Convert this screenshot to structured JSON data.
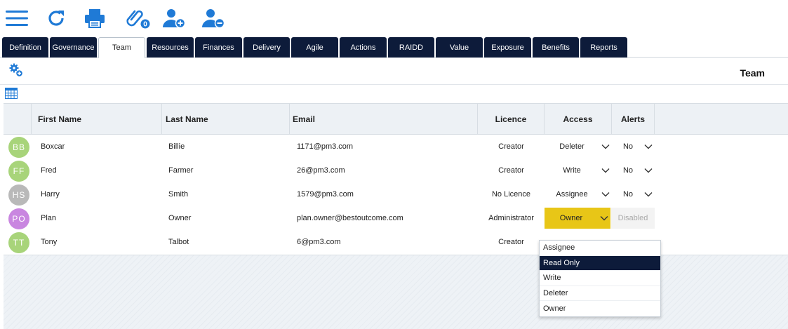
{
  "toolbar": {
    "icons": [
      "menu-icon",
      "refresh-icon",
      "print-icon",
      "paperclip-icon",
      "add-user-icon",
      "remove-user-icon"
    ],
    "attachment_count": "0",
    "accent": "#1f7ad6"
  },
  "tabs": [
    {
      "label": "Definition"
    },
    {
      "label": "Governance"
    },
    {
      "label": "Team",
      "active": true
    },
    {
      "label": "Resources"
    },
    {
      "label": "Finances"
    },
    {
      "label": "Delivery"
    },
    {
      "label": "Agile"
    },
    {
      "label": "Actions"
    },
    {
      "label": "RAIDD"
    },
    {
      "label": "Value"
    },
    {
      "label": "Exposure"
    },
    {
      "label": "Benefits"
    },
    {
      "label": "Reports"
    }
  ],
  "section": {
    "title": "Team"
  },
  "table": {
    "columns": [
      "First Name",
      "Last Name",
      "Email",
      "Licence",
      "Access",
      "Alerts"
    ],
    "rows": [
      {
        "initials": "BB",
        "avatar_color": "#a8d47a",
        "first": "Boxcar",
        "last": "Billie",
        "email": "1171@pm3.com",
        "licence": "Creator",
        "access": "Deleter",
        "alerts": "No"
      },
      {
        "initials": "FF",
        "avatar_color": "#a8d47a",
        "first": "Fred",
        "last": "Farmer",
        "email": "26@pm3.com",
        "licence": "Creator",
        "access": "Write",
        "alerts": "No"
      },
      {
        "initials": "HS",
        "avatar_color": "#b9b9b9",
        "first": "Harry",
        "last": "Smith",
        "email": "1579@pm3.com",
        "licence": "No Licence",
        "access": "Assignee",
        "alerts": "No"
      },
      {
        "initials": "PO",
        "avatar_color": "#c986e0",
        "first": "Plan",
        "last": "Owner",
        "email": "plan.owner@bestoutcome.com",
        "licence": "Administrator",
        "access": "Owner",
        "alerts": "Disabled"
      },
      {
        "initials": "TT",
        "avatar_color": "#a8d47a",
        "first": "Tony",
        "last": "Talbot",
        "email": "6@pm3.com",
        "licence": "Creator",
        "access": "",
        "alerts": ""
      }
    ]
  },
  "access_dropdown": {
    "options": [
      "Assignee",
      "Read Only",
      "Write",
      "Deleter",
      "Owner"
    ],
    "highlighted": "Read Only"
  },
  "colors": {
    "navy": "#0d1b3a",
    "owner_highlight": "#e8c617",
    "icon_blue": "#1f7ad6"
  }
}
